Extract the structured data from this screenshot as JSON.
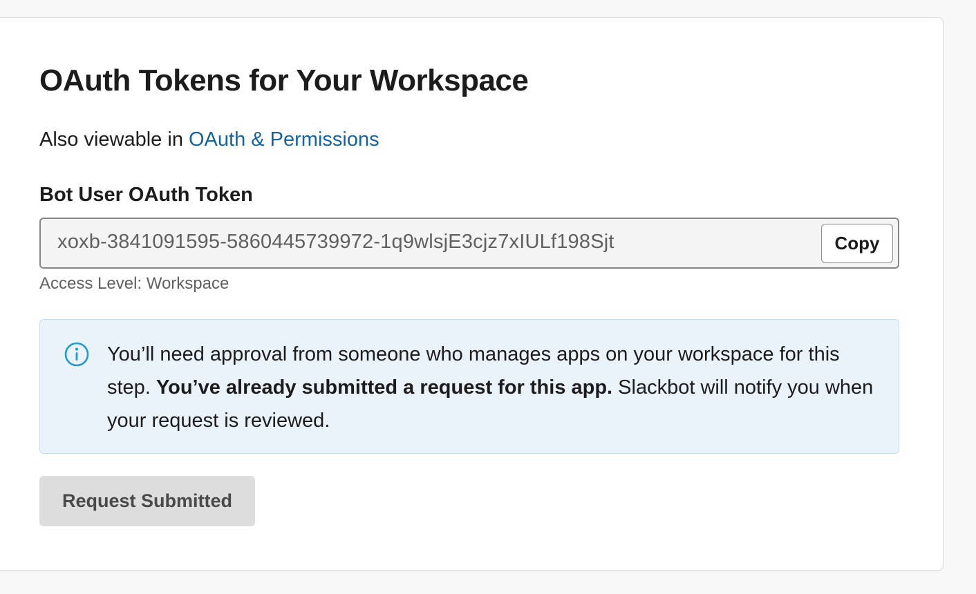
{
  "section": {
    "title": "OAuth Tokens for Your Workspace",
    "also_viewable_prefix": "Also viewable in ",
    "also_viewable_link": "OAuth & Permissions"
  },
  "token": {
    "label": "Bot User OAuth Token",
    "value": "xoxb-3841091595-5860445739972-1q9wlsjE3cjz7xIULf198Sjt",
    "copy_label": "Copy",
    "access_level": "Access Level: Workspace"
  },
  "notice": {
    "icon": "info-icon",
    "text_before": "You’ll need approval from someone who manages apps on your workspace for this step. ",
    "text_bold": "You’ve already submitted a request for this app.",
    "text_after": " Slackbot will notify you when your request is reviewed."
  },
  "actions": {
    "request_label": "Request Submitted"
  },
  "colors": {
    "link": "#1264a3",
    "notice_bg": "#ebf3fa",
    "notice_border": "#c5ddef",
    "info_icon": "#1d9bd1",
    "disabled_button_bg": "#dddddd"
  }
}
